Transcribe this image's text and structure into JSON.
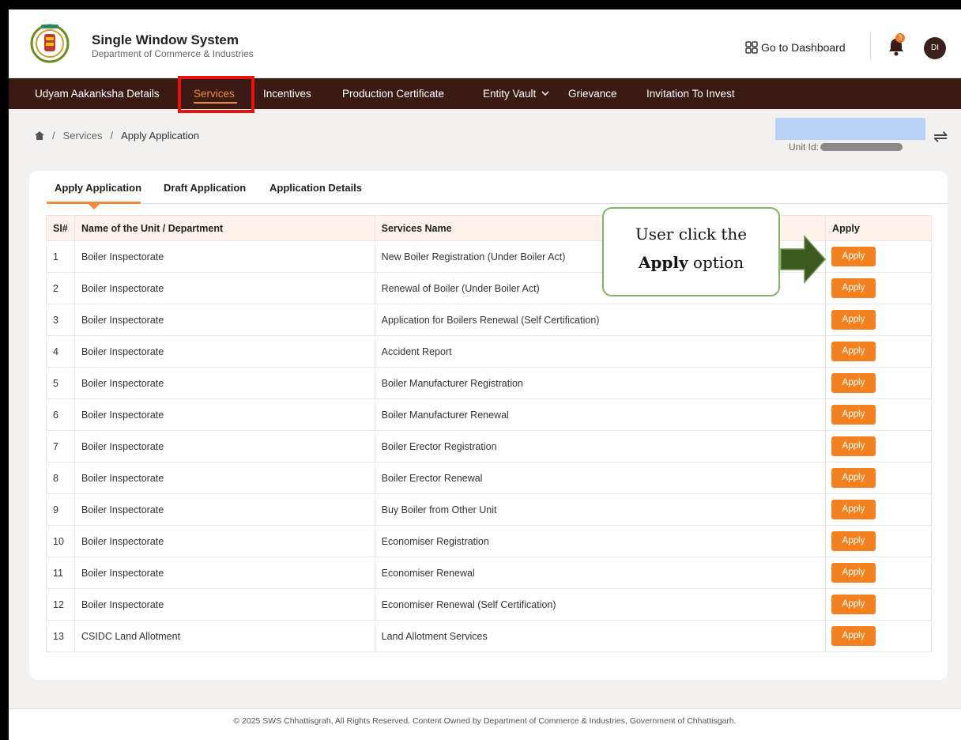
{
  "header": {
    "title": "Single Window System",
    "subtitle": "Department of Commerce & Industries",
    "dashboard_label": "Go to Dashboard",
    "notification_count": "3",
    "avatar_initials": "DI"
  },
  "nav": {
    "items": [
      {
        "label": "Udyam Aakanksha Details"
      },
      {
        "label": "Services"
      },
      {
        "label": "Incentives"
      },
      {
        "label": "Production Certificate"
      },
      {
        "label": "Entity Vault"
      },
      {
        "label": "Grievance"
      },
      {
        "label": "Invitation To Invest"
      }
    ],
    "active": "Services"
  },
  "breadcrumb": {
    "items": [
      "Services",
      "Apply Application"
    ]
  },
  "unit": {
    "label": "Unit Id:"
  },
  "tabs": [
    {
      "label": "Apply Application"
    },
    {
      "label": "Draft Application"
    },
    {
      "label": "Application Details"
    }
  ],
  "table": {
    "headers": [
      "Sl#",
      "Name of the Unit / Department",
      "Services Name",
      "Apply"
    ],
    "apply_label": "Apply",
    "rows": [
      {
        "sl": "1",
        "unit": "Boiler Inspectorate",
        "service": "New Boiler Registration (Under Boiler Act)"
      },
      {
        "sl": "2",
        "unit": "Boiler Inspectorate",
        "service": "Renewal of Boiler (Under Boiler Act)"
      },
      {
        "sl": "3",
        "unit": "Boiler Inspectorate",
        "service": "Application for Boilers Renewal (Self Certification)"
      },
      {
        "sl": "4",
        "unit": "Boiler Inspectorate",
        "service": "Accident Report"
      },
      {
        "sl": "5",
        "unit": "Boiler Inspectorate",
        "service": "Boiler Manufacturer Registration"
      },
      {
        "sl": "6",
        "unit": "Boiler Inspectorate",
        "service": "Boiler Manufacturer Renewal"
      },
      {
        "sl": "7",
        "unit": "Boiler Inspectorate",
        "service": "Boiler Erector Registration"
      },
      {
        "sl": "8",
        "unit": "Boiler Inspectorate",
        "service": "Boiler Erector Renewal"
      },
      {
        "sl": "9",
        "unit": "Boiler Inspectorate",
        "service": "Buy Boiler from Other Unit"
      },
      {
        "sl": "10",
        "unit": "Boiler Inspectorate",
        "service": "Economiser Registration"
      },
      {
        "sl": "11",
        "unit": "Boiler Inspectorate",
        "service": "Economiser Renewal"
      },
      {
        "sl": "12",
        "unit": "Boiler Inspectorate",
        "service": "Economiser Renewal (Self Certification)"
      },
      {
        "sl": "13",
        "unit": "CSIDC Land Allotment",
        "service": "Land Allotment Services"
      }
    ]
  },
  "callout": {
    "line1": "User click the",
    "line2_bold": "Apply",
    "line2_rest": " option"
  },
  "footer": {
    "text": "© 2025 SWS Chhattisgrah, All Rights Reserved. Content Owned by Department of Commerce & Industries, Government of Chhattisgarh."
  },
  "colors": {
    "nav_bg": "#3b1a14",
    "accent": "#f38120",
    "highlight": "#e8140c",
    "callout_border": "#82b366",
    "arrow": "#3a5a1f"
  },
  "icons": [
    "emblem-logo",
    "grid-icon",
    "bell-icon",
    "home-icon",
    "chevron-down-icon",
    "swap-icon",
    "arrow-right-icon"
  ]
}
